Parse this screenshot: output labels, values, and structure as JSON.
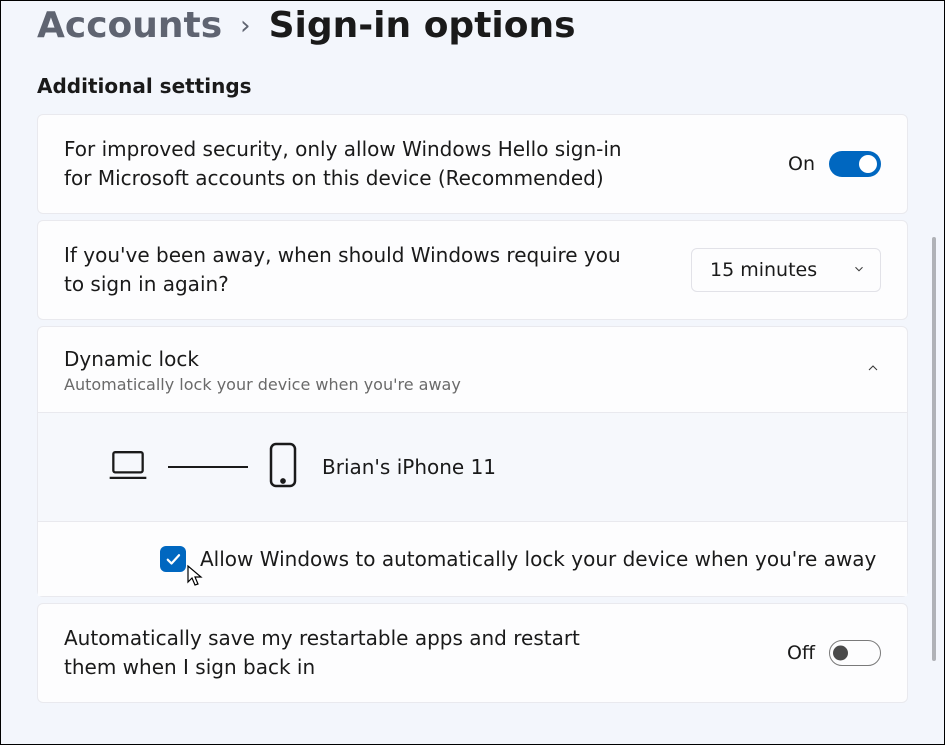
{
  "breadcrumb": {
    "parent": "Accounts",
    "separator": "›",
    "current": "Sign-in options"
  },
  "section_heading": "Additional settings",
  "hello": {
    "text": "For improved security, only allow Windows Hello sign-in for Microsoft accounts on this device (Recommended)",
    "state_label": "On",
    "state": true
  },
  "away": {
    "text": "If you've been away, when should Windows require you to sign in again?",
    "selected": "15 minutes"
  },
  "dynamic_lock": {
    "title": "Dynamic lock",
    "subtitle": "Automatically lock your device when you're away",
    "device_name": "Brian's iPhone 11",
    "checkbox_label": "Allow Windows to automatically lock your device when you're away",
    "checkbox_checked": true
  },
  "restartable": {
    "text": "Automatically save my restartable apps and restart them when I sign back in",
    "state_label": "Off",
    "state": false
  }
}
